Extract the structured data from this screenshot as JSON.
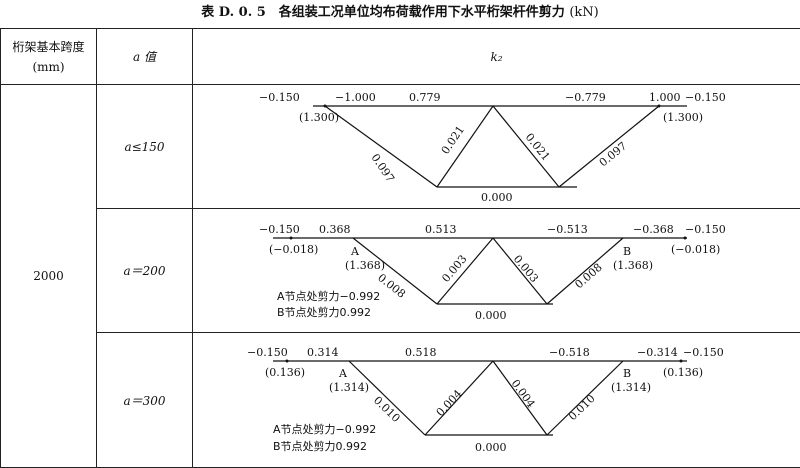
{
  "caption": {
    "title": "表 D. 0. 5　各组装工况单位均布荷载作用下水平桁架杆件剪力",
    "unit": "(kN)"
  },
  "header": {
    "span_line1": "桁架基本跨度",
    "span_line2": "(mm)",
    "a_label": "a 值",
    "k_label": "k₂"
  },
  "span_value": "2000",
  "rows": [
    {
      "a_value": "a≤150",
      "left_end": "−0.150",
      "top_left": "−1.000",
      "top_mid_left": "0.779",
      "top_mid_right": "−0.779",
      "top_right": "1.000",
      "right_end": "−0.150",
      "paren_left": "(1.300)",
      "paren_right": "(1.300)",
      "diag_1": "0.097",
      "diag_2": "0.021",
      "diag_3": "0.021",
      "diag_4": "0.097",
      "bottom": "0.000"
    },
    {
      "a_value": "a＝200",
      "left_end": "−0.150",
      "top_left": "0.368",
      "top_mid_left": "0.513",
      "top_mid_right": "−0.513",
      "top_right": "−0.368",
      "right_end": "−0.150",
      "paren_left": "(−0.018)",
      "paren_right": "(−0.018)",
      "node_a": "A",
      "node_a_val": "(1.368)",
      "node_b": "B",
      "node_b_val": "(1.368)",
      "diag_1": "0.008",
      "diag_2": "0.003",
      "diag_3": "0.003",
      "diag_4": "0.008",
      "bottom": "0.000",
      "note_a": "A节点处剪力−0.992",
      "note_b": "B节点处剪力0.992"
    },
    {
      "a_value": "a＝300",
      "left_end": "−0.150",
      "top_left": "0.314",
      "top_mid_left": "0.518",
      "top_mid_right": "−0.518",
      "top_right": "−0.314",
      "right_end": "−0.150",
      "paren_left": "(0.136)",
      "paren_right": "(0.136)",
      "node_a": "A",
      "node_a_val": "(1.314)",
      "node_b": "B",
      "node_b_val": "(1.314)",
      "diag_1": "0.010",
      "diag_2": "0.004",
      "diag_3": "0.004",
      "diag_4": "0.010",
      "bottom": "0.000",
      "note_a": "A节点处剪力−0.992",
      "note_b": "B节点处剪力0.992"
    }
  ]
}
